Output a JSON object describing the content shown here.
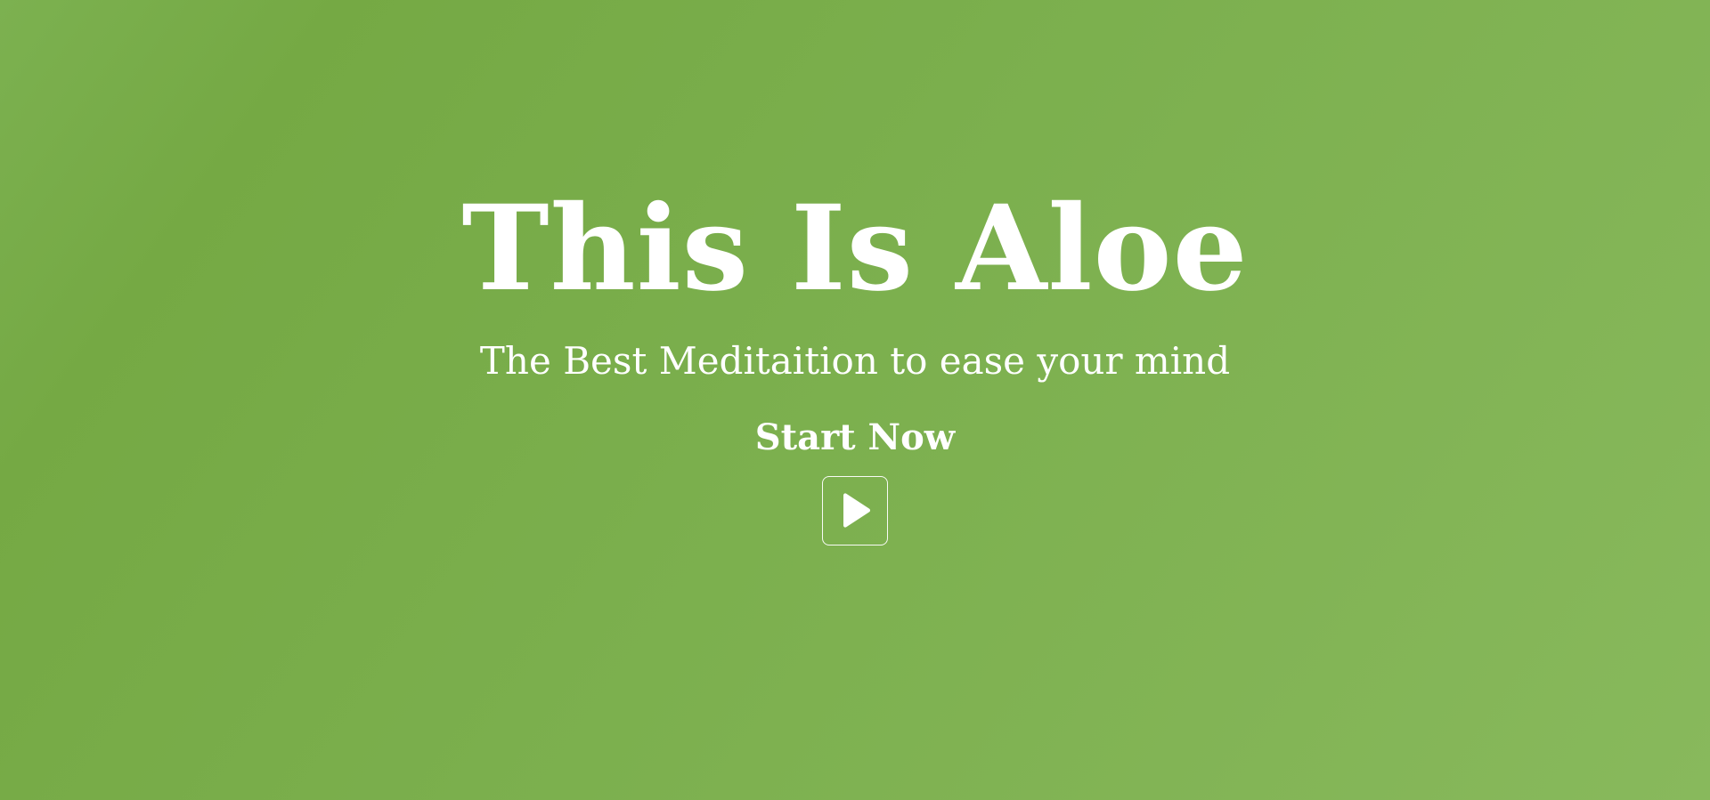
{
  "hero": {
    "title": "This Is Aloe",
    "subtitle": "The Best Meditaition to ease your mind",
    "cta_label": "Start Now",
    "play_icon": "play-icon"
  },
  "colors": {
    "background_start": "#7cb150",
    "background_mid": "#7baf4d",
    "background_end": "#88b95c",
    "text": "#ffffff"
  }
}
